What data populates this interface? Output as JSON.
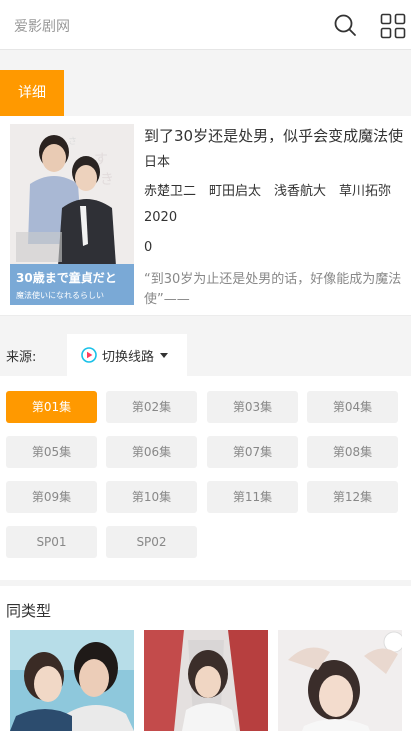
{
  "header": {
    "logo": "爱影剧网"
  },
  "tabs": [
    {
      "label": "详细"
    }
  ],
  "detail": {
    "title": "到了30岁还是处男，似乎会变成魔法使",
    "country": "日本",
    "cast": "赤楚卫二　町田启太　浅香航大　草川拓弥",
    "year": "2020",
    "score": "0",
    "description": "“到30岁为止还是处男的话，好像能成为魔法使”——",
    "poster_text": {
      "line1": "30歳まで童貞だと",
      "line2": "魔法使いになれるらしい"
    }
  },
  "source": {
    "label": "来源:",
    "switch_label": "切换线路"
  },
  "episodes": [
    "第01集",
    "第02集",
    "第03集",
    "第04集",
    "第05集",
    "第06集",
    "第07集",
    "第08集",
    "第09集",
    "第10集",
    "第11集",
    "第12集",
    "SP01",
    "SP02"
  ],
  "active_episode": "第01集",
  "related": {
    "title": "同类型"
  },
  "colors": {
    "accent": "#ff9900",
    "page_bg": "#f4f4f4"
  }
}
